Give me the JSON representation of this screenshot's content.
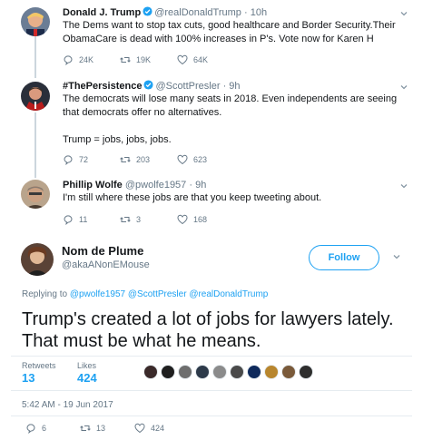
{
  "thread": [
    {
      "name": "Donald J. Trump",
      "verified": true,
      "handle": "@realDonaldTrump",
      "time": "10h",
      "text": "The Dems want to stop tax cuts, good healthcare and Border Security.Their ObamaCare is dead with 100% increases in P's. Vote now for Karen H",
      "replies": "24K",
      "retweets": "19K",
      "likes": "64K"
    },
    {
      "name": "#ThePersistence",
      "verified": true,
      "handle": "@ScottPresler",
      "time": "9h",
      "text": "The democrats will lose many seats in 2018. Even independents are seeing that democrats offer no alternatives.\n\nTrump = jobs, jobs, jobs.",
      "replies": "72",
      "retweets": "203",
      "likes": "623"
    },
    {
      "name": "Phillip Wolfe",
      "verified": false,
      "handle": "@pwolfe1957",
      "time": "9h",
      "text": "I'm still where these jobs are that you keep tweeting about.",
      "replies": "11",
      "retweets": "3",
      "likes": "168"
    }
  ],
  "main": {
    "name": "Nom de Plume",
    "handle": "@akaANonEMouse",
    "follow_label": "Follow",
    "replying_prefix": "Replying to",
    "replying_to": [
      "@pwolfe1957",
      "@ScottPresler",
      "@realDonaldTrump"
    ],
    "text": "Trump's created a lot of jobs for lawyers lately. That must be what he means.",
    "retweets_label": "Retweets",
    "retweets": "13",
    "likes_label": "Likes",
    "likes": "424",
    "date": "5:42 AM - 19 Jun 2017",
    "replies_count": "6",
    "retweets_count": "13",
    "likes_count": "424"
  },
  "colors": {
    "accent": "#1da1f2",
    "muted": "#657786",
    "text": "#14171a",
    "divider": "#e6ecf0"
  },
  "icons": [
    "reply-icon",
    "retweet-icon",
    "like-icon",
    "verified-badge-icon",
    "chevron-down-icon"
  ]
}
